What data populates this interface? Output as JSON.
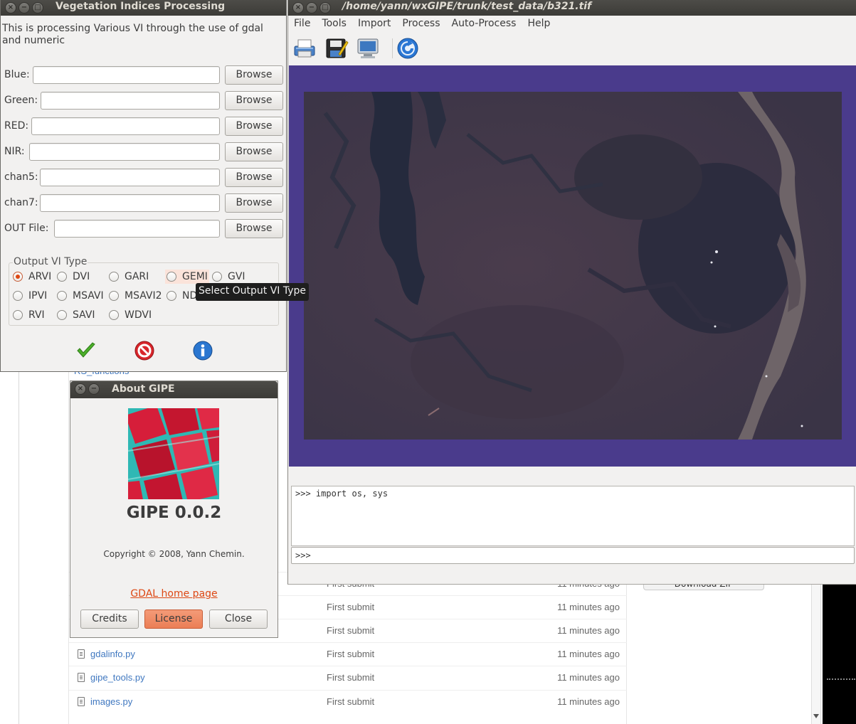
{
  "background_page": {
    "folder_link": "RS_functions",
    "download_button": "Download ZIP",
    "rows": [
      {
        "file": "",
        "commit": "First submit",
        "age": "11 minutes ago"
      },
      {
        "file": "",
        "commit": "First submit",
        "age": "11 minutes ago"
      },
      {
        "file": "",
        "commit": "First submit",
        "age": "11 minutes ago"
      },
      {
        "file": "gdalinfo.py",
        "commit": "First submit",
        "age": "11 minutes ago"
      },
      {
        "file": "gipe_tools.py",
        "commit": "First submit",
        "age": "11 minutes ago"
      },
      {
        "file": "images.py",
        "commit": "First submit",
        "age": "11 minutes ago"
      }
    ]
  },
  "main_window": {
    "title": "/home/yann/wxGIPE/trunk/test_data/b321.tif",
    "menu": [
      "File",
      "Tools",
      "Import",
      "Process",
      "Auto-Process",
      "Help"
    ],
    "toolbar_icons": [
      "printer-icon",
      "save-icon",
      "screen-icon",
      "refresh-icon"
    ],
    "canvas_color": "#4a3b8c",
    "console_output": ">>> import os, sys",
    "console_prompt": ">>>"
  },
  "vi_dialog": {
    "title": "Vegetation Indices Processing",
    "description": "This is processing Various VI through the use of gdal and numeric",
    "fields": [
      {
        "label": "Blue:",
        "value": "",
        "browse": "Browse"
      },
      {
        "label": "Green:",
        "value": "",
        "browse": "Browse"
      },
      {
        "label": "RED:",
        "value": "",
        "browse": "Browse"
      },
      {
        "label": "NIR:",
        "value": "",
        "browse": "Browse"
      },
      {
        "label": "chan5:",
        "value": "",
        "browse": "Browse"
      },
      {
        "label": "chan7:",
        "value": "",
        "browse": "Browse"
      },
      {
        "label": "OUT File:",
        "value": "",
        "browse": "Browse"
      }
    ],
    "group_label": "Output VI Type",
    "options": [
      "ARVI",
      "DVI",
      "GARI",
      "GEMI",
      "GVI",
      "IPVI",
      "MSAVI",
      "MSAVI2",
      "ND",
      "RVI",
      "SAVI",
      "WDVI"
    ],
    "selected": "ARVI",
    "tooltip": "Select Output VI Type",
    "accent": "#dd4814"
  },
  "about_dialog": {
    "title": "About GIPE",
    "name": "GIPE 0.0.2",
    "copyright": "Copyright © 2008, Yann Chemin.",
    "link": "GDAL home page",
    "buttons": {
      "credits": "Credits",
      "license": "License",
      "close": "Close"
    }
  }
}
